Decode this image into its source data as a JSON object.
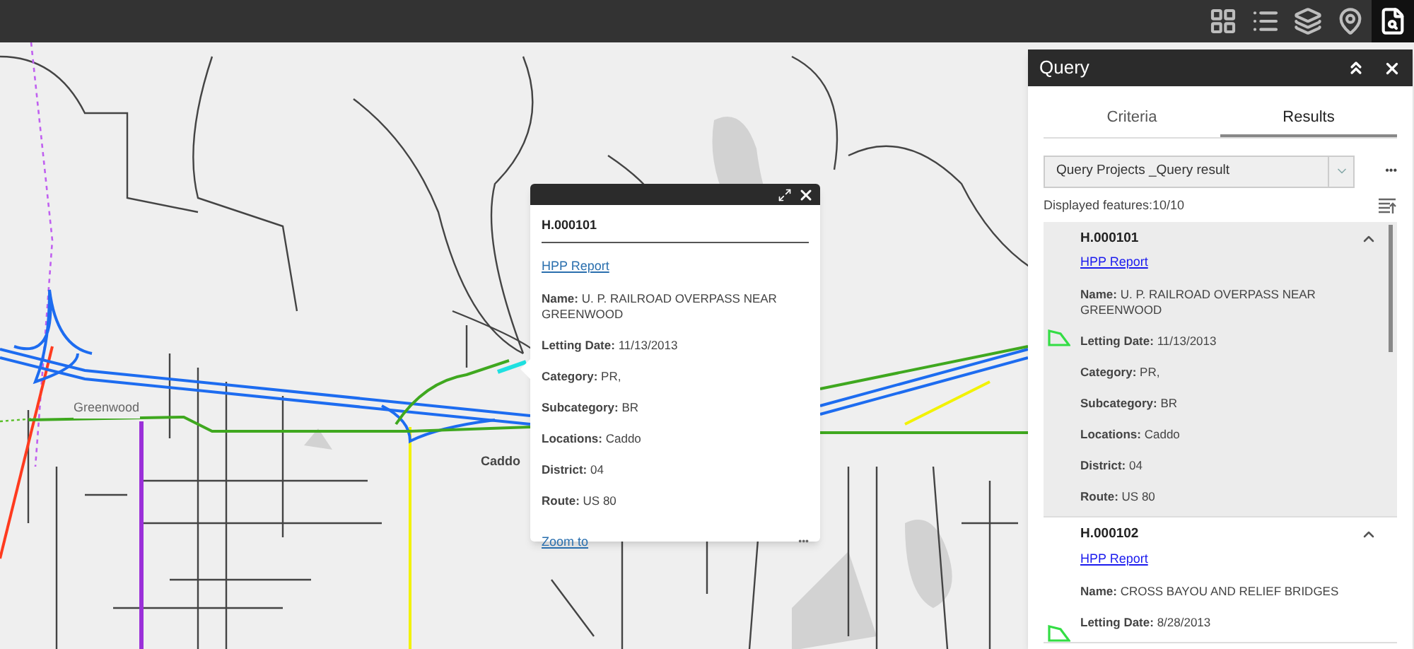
{
  "toolbar": [
    {
      "kind": "grid",
      "selected": false
    },
    {
      "kind": "list",
      "selected": false
    },
    {
      "kind": "layers",
      "selected": false
    },
    {
      "kind": "map-search",
      "selected": false
    },
    {
      "kind": "query",
      "selected": true
    }
  ],
  "map": {
    "labels": [
      {
        "kind": "town",
        "text": "Greenwood"
      },
      {
        "kind": "parish",
        "text": "Caddo"
      }
    ]
  },
  "popup": {
    "title": "H.000101",
    "link": "HPP Report",
    "fields": [
      "**Name:** U. P. RAILROAD OVERPASS NEAR GREENWOOD",
      "**Letting Date:** 11/13/2013",
      "**Category:** PR,",
      "**Subcategory:** BR",
      "**Locations:** Caddo",
      "**District:** 04",
      "**Route:** US 80"
    ],
    "action": "Zoom to",
    "more": "•••"
  },
  "panel": {
    "title": "Query",
    "tabs": [
      {
        "label": "Criteria",
        "selected": false
      },
      {
        "label": "Results",
        "selected": true
      }
    ],
    "dropdown": {
      "value": "Query Projects _Query result"
    },
    "more": "•••",
    "count": "Displayed features:10/10",
    "results": [
      {
        "title": "H.000101",
        "link": "HPP Report",
        "selected": true,
        "fields": [
          "**Name:** U. P. RAILROAD OVERPASS NEAR GREENWOOD",
          "**Letting Date:** 11/13/2013",
          "**Category:** PR,",
          "**Subcategory:** BR",
          "**Locations:** Caddo",
          "**District:** 04",
          "**Route:** US 80"
        ]
      },
      {
        "title": "H.000102",
        "link": "HPP Report",
        "selected": false,
        "fields": [
          "**Name:** CROSS BAYOU AND RELIEF BRIDGES",
          "**Letting Date:** 8/28/2013"
        ]
      }
    ]
  }
}
